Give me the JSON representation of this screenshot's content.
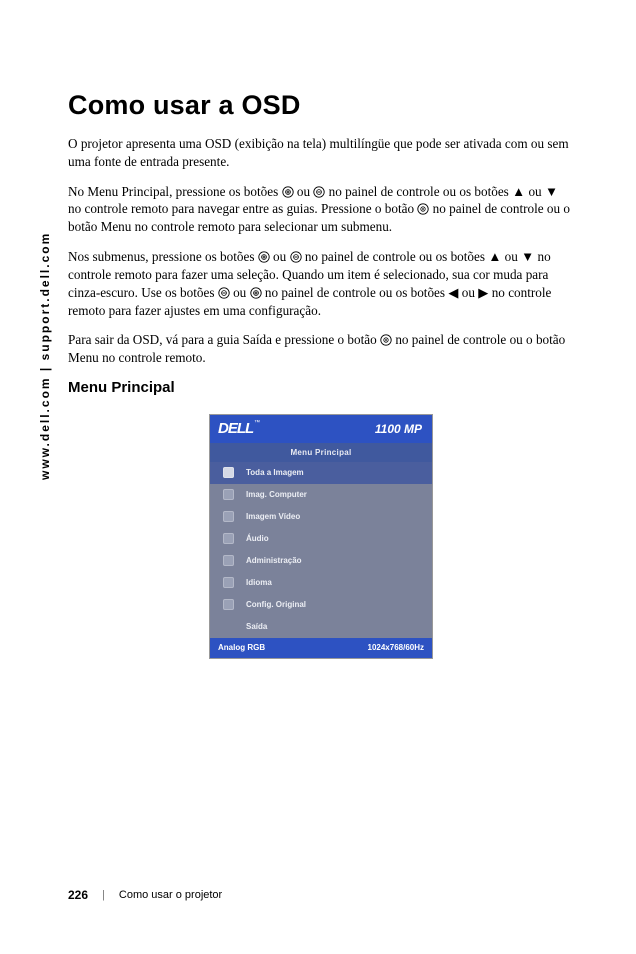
{
  "sidebar_text": "www.dell.com | support.dell.com",
  "heading": "Como usar a OSD",
  "p1a": "O projetor apresenta uma OSD (exibição na tela) multilíngüe que pode ser ativada com ou sem uma fonte de entrada presente.",
  "p2_prefix": "No Menu Principal, pressione os botões ",
  "p2_mid1": " ou ",
  "p2_mid2": " no painel de controle ou os botões ▲ ou ▼ no controle remoto para navegar entre as guias. Pressione o botão ",
  "p2_suffix": " no painel de controle ou o botão Menu no controle remoto para selecionar um submenu.",
  "p3_prefix": "Nos submenus, pressione os botões ",
  "p3_mid1": " ou ",
  "p3_mid2": " no painel de controle ou os botões ▲ ou ▼ no controle remoto para fazer uma seleção. Quando um item é selecionado, sua cor muda para cinza-escuro. Use os botões ",
  "p3_mid3": " ou ",
  "p3_mid4": " no painel de controle ou os botões ◀ ou ▶ no controle remoto para fazer ajustes em uma configuração.",
  "p4_prefix": "Para sair da OSD, vá para a guia Saída e pressione o botão ",
  "p4_suffix": " no painel de controle ou o botão Menu no controle remoto.",
  "subheading": "Menu Principal",
  "osd": {
    "logo": "DELL",
    "model": "1100 MP",
    "title": "Menu Principal",
    "items": [
      "Toda a Imagem",
      "Imag. Computer",
      "Imagem Vídeo",
      "Áudio",
      "Administração",
      "Idioma",
      "Config. Original",
      "Saída"
    ],
    "footer_left": "Analog RGB",
    "footer_right": "1024x768/60Hz"
  },
  "footer": {
    "page": "226",
    "section": "Como usar o projetor"
  }
}
